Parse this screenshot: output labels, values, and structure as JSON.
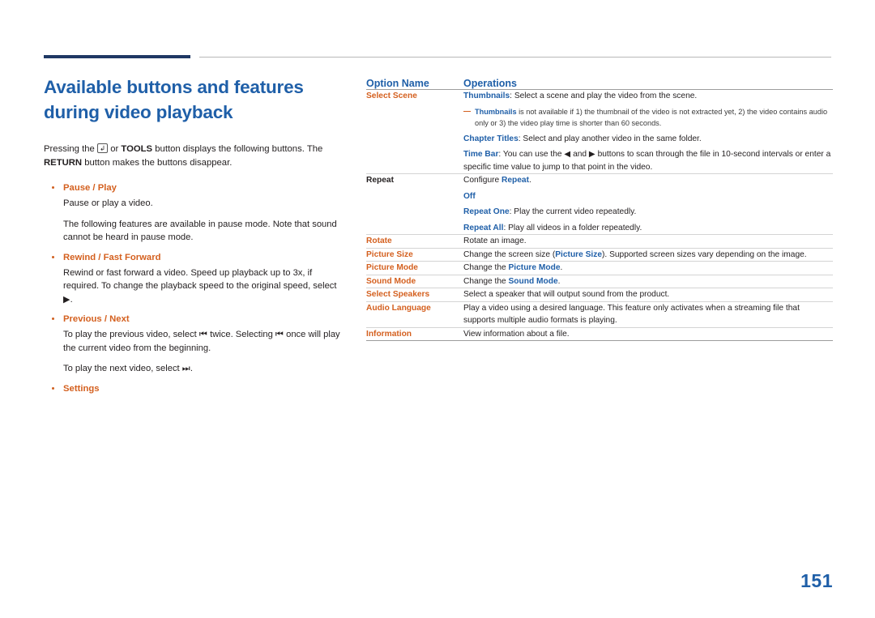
{
  "left": {
    "title_line1": "Available buttons and features",
    "title_line2": "during video playback",
    "intro_pre": "Pressing the ",
    "intro_key": "↲",
    "intro_mid": " or ",
    "intro_tools": "TOOLS",
    "intro_mid2": " button displays the following buttons. The ",
    "intro_return": "RETURN",
    "intro_post": " button makes the buttons disappear.",
    "bullets": [
      {
        "head": "Pause / Play",
        "body": [
          "Pause or play a video.",
          "The following features are available in pause mode. Note that sound cannot be heard in pause mode."
        ]
      },
      {
        "head": "Rewind / Fast Forward",
        "body": [
          "Rewind or fast forward a video. Speed up playback up to 3x, if required. To change the playback speed to the original speed, select ▶."
        ]
      },
      {
        "head": "Previous / Next",
        "body": [
          "To play the previous video, select ⏮ twice. Selecting ⏮ once will play the current video from the beginning.",
          "To play the next video, select ⏭."
        ]
      },
      {
        "head": "Settings",
        "body": []
      }
    ]
  },
  "table": {
    "headers": [
      "Option Name",
      "Operations"
    ],
    "rows": [
      {
        "name": "Select Scene",
        "name_color": "orange",
        "lines": [
          {
            "type": "text",
            "parts": [
              {
                "t": "Thumbnails",
                "s": "blue"
              },
              {
                "t": ": Select a scene and play the video from the scene.",
                "s": "plain"
              }
            ]
          },
          {
            "type": "note",
            "parts": [
              {
                "t": "Thumbnails",
                "s": "blue"
              },
              {
                "t": " is not available if 1) the thumbnail of the video is not extracted yet, 2) the video contains audio only or 3) the video play time is shorter than 60 seconds.",
                "s": "plain"
              }
            ]
          },
          {
            "type": "text",
            "parts": [
              {
                "t": "Chapter Titles",
                "s": "blue"
              },
              {
                "t": ": Select and play another video in the same folder.",
                "s": "plain"
              }
            ]
          },
          {
            "type": "text",
            "parts": [
              {
                "t": "Time Bar",
                "s": "blue"
              },
              {
                "t": ": You can use the ◀ and ▶ buttons to scan through the file in 10-second intervals or enter a specific time value to jump to that point in the video.",
                "s": "plain"
              }
            ]
          }
        ]
      },
      {
        "name": "Repeat",
        "name_color": "plain",
        "lines": [
          {
            "type": "text",
            "parts": [
              {
                "t": "Configure ",
                "s": "plain"
              },
              {
                "t": "Repeat",
                "s": "blue"
              },
              {
                "t": ".",
                "s": "plain"
              }
            ]
          },
          {
            "type": "text",
            "parts": [
              {
                "t": "Off",
                "s": "blue"
              }
            ]
          },
          {
            "type": "text",
            "parts": [
              {
                "t": "Repeat One",
                "s": "blue"
              },
              {
                "t": ": Play the current video repeatedly.",
                "s": "plain"
              }
            ]
          },
          {
            "type": "text",
            "parts": [
              {
                "t": "Repeat All",
                "s": "blue"
              },
              {
                "t": ": Play all videos in a folder repeatedly.",
                "s": "plain"
              }
            ]
          }
        ]
      },
      {
        "name": "Rotate",
        "name_color": "orange",
        "lines": [
          {
            "type": "text",
            "parts": [
              {
                "t": "Rotate an image.",
                "s": "plain"
              }
            ]
          }
        ]
      },
      {
        "name": "Picture Size",
        "name_color": "orange",
        "lines": [
          {
            "type": "text",
            "parts": [
              {
                "t": "Change the screen size (",
                "s": "plain"
              },
              {
                "t": "Picture Size",
                "s": "blue"
              },
              {
                "t": "). Supported screen sizes vary depending on the image.",
                "s": "plain"
              }
            ]
          }
        ]
      },
      {
        "name": "Picture Mode",
        "name_color": "orange",
        "lines": [
          {
            "type": "text",
            "parts": [
              {
                "t": "Change the ",
                "s": "plain"
              },
              {
                "t": "Picture Mode",
                "s": "blue"
              },
              {
                "t": ".",
                "s": "plain"
              }
            ]
          }
        ]
      },
      {
        "name": "Sound Mode",
        "name_color": "orange",
        "lines": [
          {
            "type": "text",
            "parts": [
              {
                "t": "Change the ",
                "s": "plain"
              },
              {
                "t": "Sound Mode",
                "s": "blue"
              },
              {
                "t": ".",
                "s": "plain"
              }
            ]
          }
        ]
      },
      {
        "name": "Select Speakers",
        "name_color": "orange",
        "lines": [
          {
            "type": "text",
            "parts": [
              {
                "t": "Select a speaker that will output sound from the product.",
                "s": "plain"
              }
            ]
          }
        ]
      },
      {
        "name": "Audio Language",
        "name_color": "orange",
        "lines": [
          {
            "type": "text",
            "parts": [
              {
                "t": "Play a video using a desired language. This feature only activates when a streaming file that supports multiple audio formats is playing.",
                "s": "plain"
              }
            ]
          }
        ]
      },
      {
        "name": "Information",
        "name_color": "orange",
        "lines": [
          {
            "type": "text",
            "parts": [
              {
                "t": "View information about a file.",
                "s": "plain"
              }
            ]
          }
        ]
      }
    ]
  },
  "page_number": "151",
  "colors": {
    "title_blue": "#1f5fa8",
    "accent_orange": "#d4601f",
    "rule_dark": "#1f3864"
  }
}
